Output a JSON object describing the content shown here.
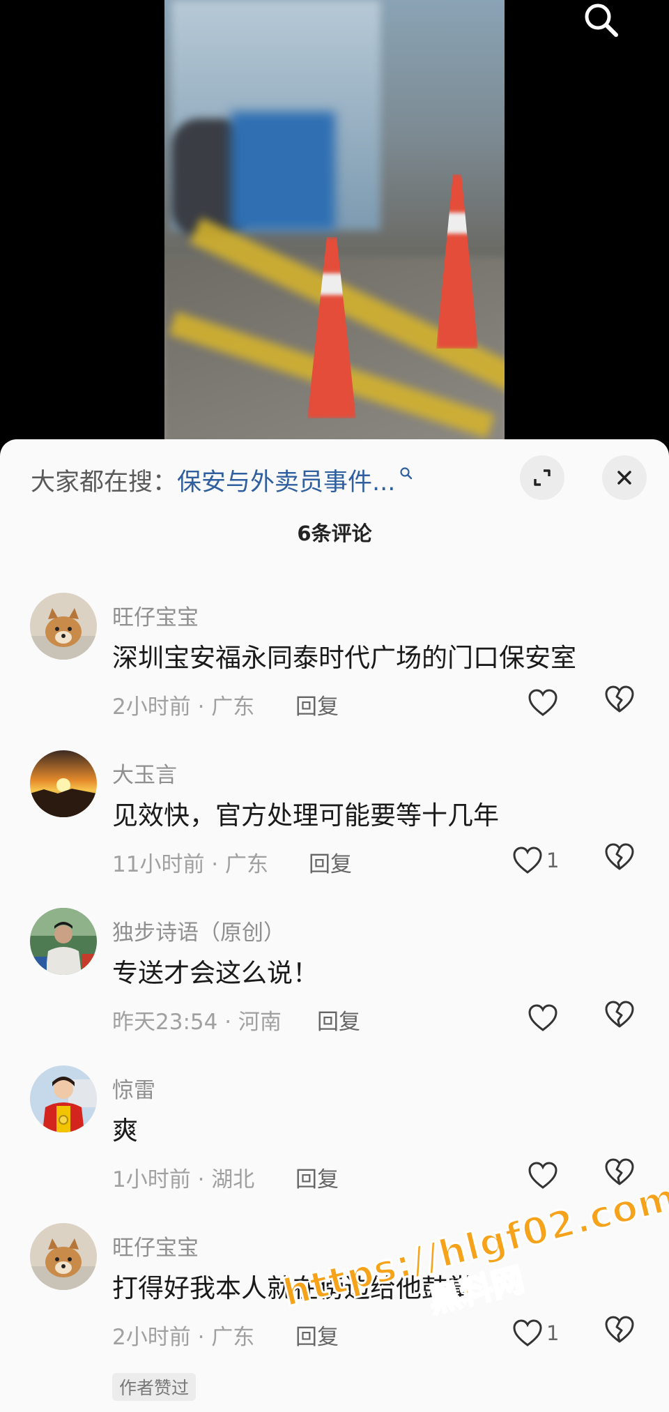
{
  "search_bar": {
    "label": "大家都在搜：",
    "term": "保安与外卖员事件..."
  },
  "comments_count": "6条评论",
  "comments": [
    {
      "user": "旺仔宝宝",
      "text": "深圳宝安福永同泰时代广场的门口保安室",
      "time": "2小时前 · 广东",
      "reply": "回复",
      "likes": ""
    },
    {
      "user": "大玉言",
      "text": "见效快，官方处理可能要等十几年",
      "time": "11小时前 · 广东",
      "reply": "回复",
      "likes": "1"
    },
    {
      "user": "独步诗语（原创）",
      "text": "专送才会这么说！",
      "time": "昨天23:54 · 河南",
      "reply": "回复",
      "likes": ""
    },
    {
      "user": "惊雷",
      "text": "爽",
      "time": "1小时前 · 湖北",
      "reply": "回复",
      "likes": ""
    },
    {
      "user": "旺仔宝宝",
      "text": "打得好我本人就在傍边给他鼓掌",
      "time": "2小时前 · 广东",
      "reply": "回复",
      "likes": "1",
      "tag": "作者赞过"
    }
  ],
  "watermark": {
    "line1": "https://hlgf02.com",
    "line2": "黑料网"
  },
  "colors": {
    "link": "#2f5f9e",
    "panel_bg": "#fafafa",
    "watermark": "#f6a21a"
  },
  "icons": [
    "search-icon",
    "expand-icon",
    "close-icon",
    "heart-icon",
    "broken-heart-icon"
  ]
}
